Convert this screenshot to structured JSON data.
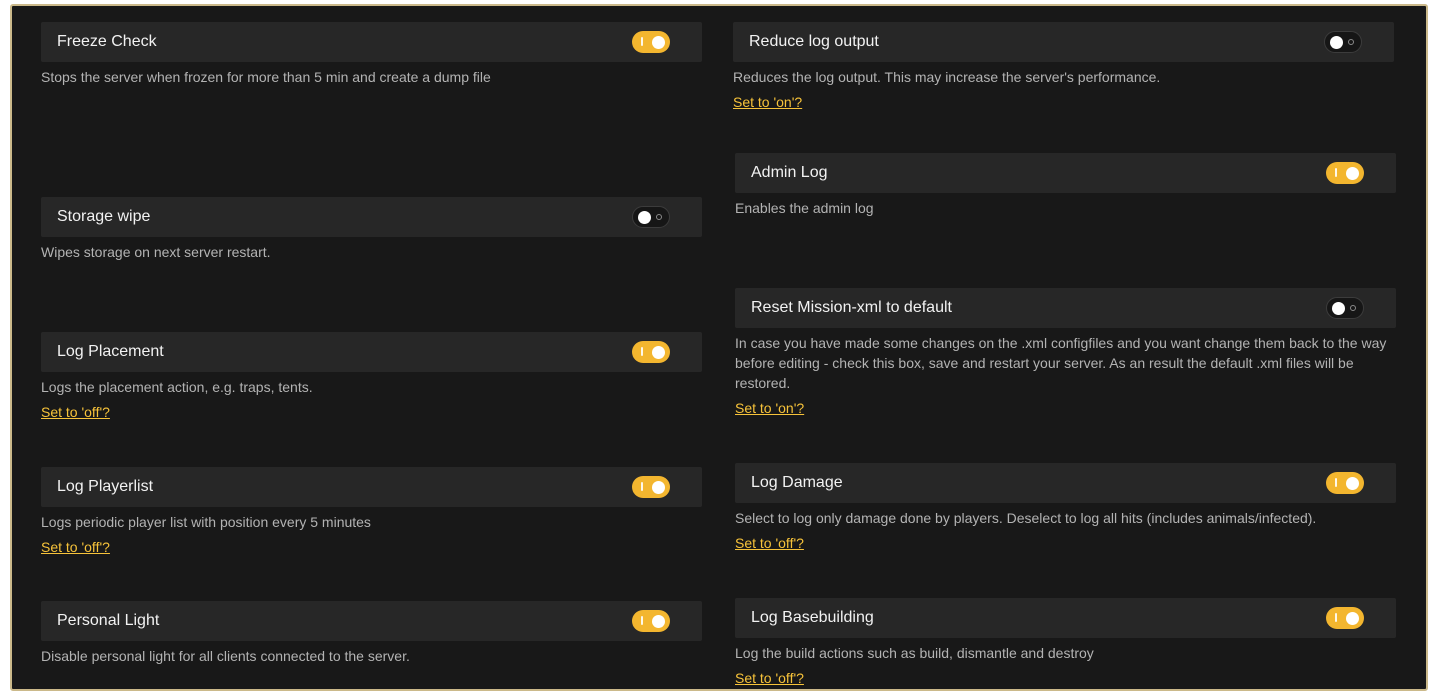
{
  "settings": [
    {
      "title": "Freeze Check",
      "state": "on",
      "description": "Stops the server when frozen for more than 5 min and create a dump file",
      "link": ""
    },
    {
      "title": "Storage wipe",
      "state": "off",
      "description": "Wipes storage on next server restart.",
      "link": ""
    },
    {
      "title": "Log Placement",
      "state": "on",
      "description": "Logs the placement action, e.g. traps, tents.",
      "link": "Set to 'off'?"
    },
    {
      "title": "Log Playerlist",
      "state": "on",
      "description": "Logs periodic player list with position every 5 minutes",
      "link": "Set to 'off'?"
    },
    {
      "title": "Personal Light",
      "state": "on",
      "description": "Disable personal light for all clients connected to the server.",
      "link": ""
    },
    {
      "title": "Reduce log output",
      "state": "off",
      "description": "Reduces the log output. This may increase the server's performance.",
      "link": "Set to 'on'?"
    },
    {
      "title": "Admin Log",
      "state": "on",
      "description": "Enables the admin log",
      "link": ""
    },
    {
      "title": "Reset Mission-xml to default",
      "state": "off",
      "description": "In case you have made some changes on the .xml configfiles and you want change them back to the way before editing - check this box, save and restart your server. As an result the default .xml files will be restored.",
      "link": "Set to 'on'?"
    },
    {
      "title": "Log Damage",
      "state": "on",
      "description": "Select to log only damage done by players. Deselect to log all hits (includes animals/infected).",
      "link": "Set to 'off'?"
    },
    {
      "title": "Log Basebuilding",
      "state": "on",
      "description": "Log the build actions such as build, dismantle and destroy",
      "link": "Set to 'off'?"
    }
  ],
  "colors": {
    "accent": "#f3b62f",
    "link": "#f7c33a",
    "background": "#181818",
    "bar": "#272727"
  }
}
